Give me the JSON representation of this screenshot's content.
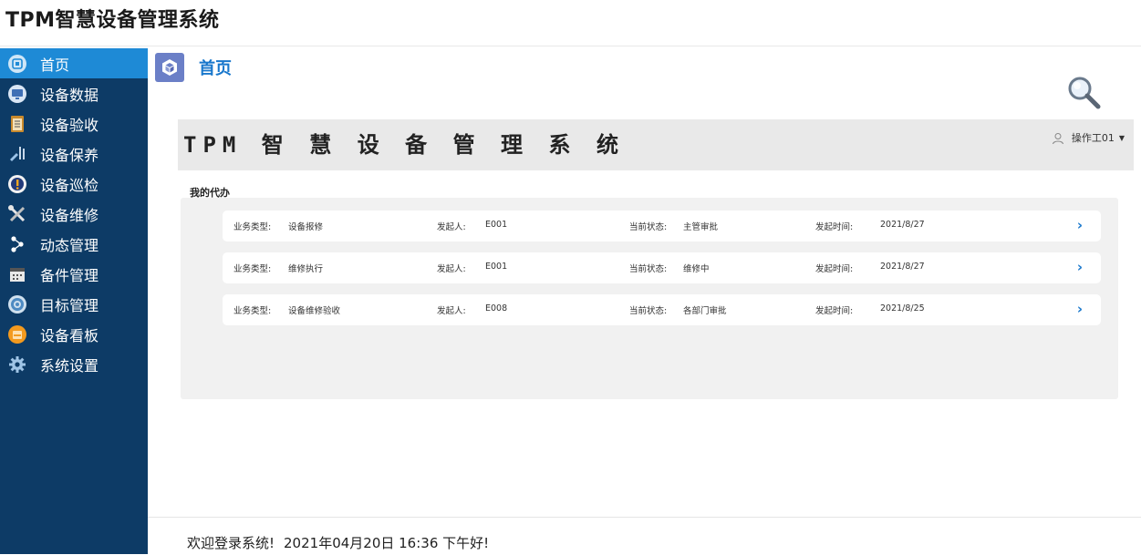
{
  "app": {
    "title": "TPM智慧设备管理系统"
  },
  "sidebar": {
    "items": [
      {
        "label": "首页",
        "icon": "home-icon",
        "active": true
      },
      {
        "label": "设备数据",
        "icon": "monitor-icon",
        "active": false
      },
      {
        "label": "设备验收",
        "icon": "clipboard-icon",
        "active": false
      },
      {
        "label": "设备保养",
        "icon": "maintenance-icon",
        "active": false
      },
      {
        "label": "设备巡检",
        "icon": "inspection-icon",
        "active": false
      },
      {
        "label": "设备维修",
        "icon": "tools-icon",
        "active": false
      },
      {
        "label": "动态管理",
        "icon": "share-icon",
        "active": false
      },
      {
        "label": "备件管理",
        "icon": "calendar-icon",
        "active": false
      },
      {
        "label": "目标管理",
        "icon": "target-icon",
        "active": false
      },
      {
        "label": "设备看板",
        "icon": "dashboard-icon",
        "active": false
      },
      {
        "label": "系统设置",
        "icon": "gear-icon",
        "active": false
      }
    ]
  },
  "page": {
    "title": "首页"
  },
  "banner": {
    "title": "TPM 智 慧 设 备 管 理 系 统",
    "user": "操作工01"
  },
  "todo": {
    "heading": "我的代办",
    "labels": {
      "type": "业务类型:",
      "initiator": "发起人:",
      "status": "当前状态:",
      "time": "发起时间:"
    },
    "rows": [
      {
        "type": "设备报修",
        "initiator": "E001",
        "status": "主管审批",
        "time": "2021/8/27"
      },
      {
        "type": "维修执行",
        "initiator": "E001",
        "status": "维修中",
        "time": "2021/8/27"
      },
      {
        "type": "设备维修验收",
        "initiator": "E008",
        "status": "各部门审批",
        "time": "2021/8/25"
      }
    ]
  },
  "footer": {
    "welcome": "欢迎登录系统!",
    "datetime": "2021年04月20日 16:36",
    "greeting": "下午好!"
  },
  "colors": {
    "sidebar": "#0d3b66",
    "active": "#1e8ad6",
    "accent": "#1877cc"
  }
}
